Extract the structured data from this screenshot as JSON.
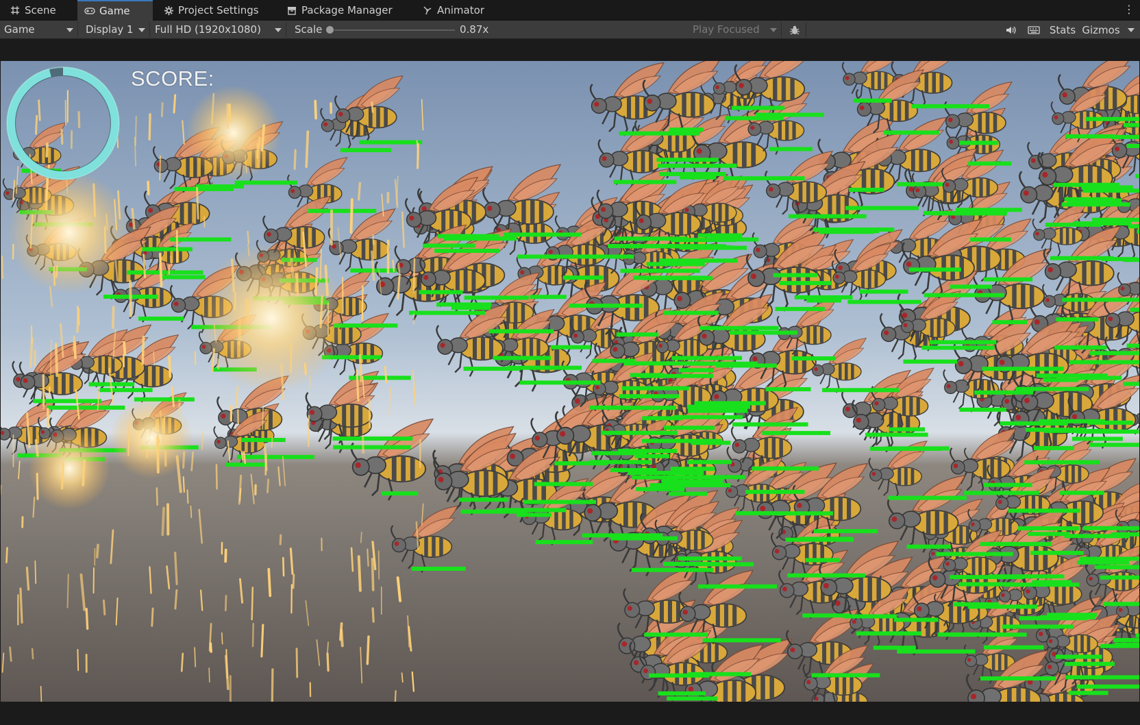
{
  "tabs": [
    {
      "label": "Scene",
      "icon": "grid-icon",
      "active": false
    },
    {
      "label": "Game",
      "icon": "gamepad-icon",
      "active": true
    },
    {
      "label": "Project Settings",
      "icon": "gear-icon",
      "active": false
    },
    {
      "label": "Package Manager",
      "icon": "package-icon",
      "active": false
    },
    {
      "label": "Animator",
      "icon": "animator-icon",
      "active": false
    }
  ],
  "toolbar": {
    "view_mode": "Game",
    "display": "Display 1",
    "resolution": "Full HD (1920x1080)",
    "scale_label": "Scale",
    "scale_value": "0.87x",
    "scale_fraction": 0.0,
    "play_mode": "Play Focused",
    "stats_label": "Stats",
    "gizmos_label": "Gizmos"
  },
  "game": {
    "score_label": "SCORE:",
    "timer_ring_fill": 0.96,
    "colors": {
      "ring": "#7fe0dc",
      "health_bar": "#18e01c",
      "wing": "#d98a62",
      "body_yellow": "#d9a83a",
      "sky_top": "#7f97b3",
      "ground": "#6b625c",
      "spark": "#ffd27a"
    }
  }
}
